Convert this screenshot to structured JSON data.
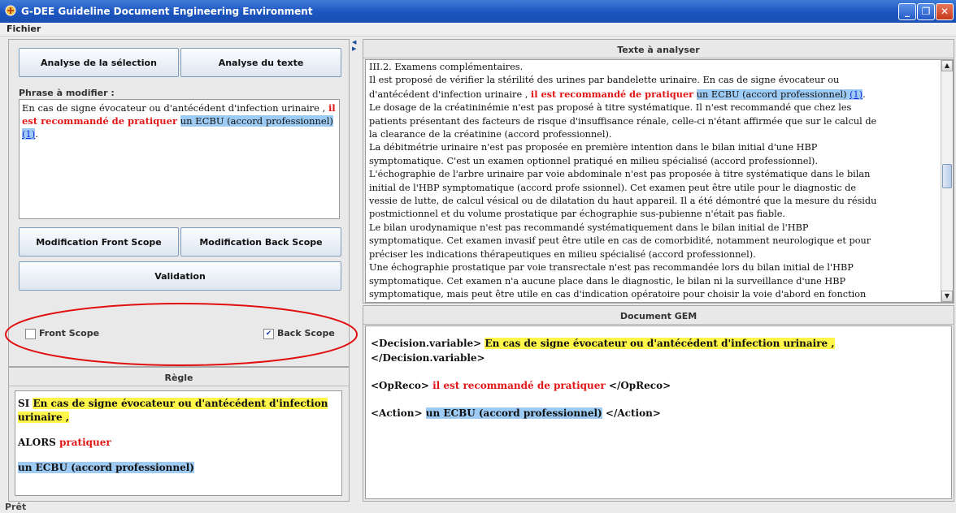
{
  "window": {
    "title": "G-DEE Guideline Document Engineering Environment",
    "minimize": "_",
    "maximize": "❐",
    "close": "✕"
  },
  "menu": {
    "fichier": "Fichier"
  },
  "left": {
    "btn_analyse_selection": "Analyse de la sélection",
    "btn_analyse_texte": "Analyse du texte",
    "phrase_label": "Phrase à modifier :",
    "phrase": {
      "part1": "En cas de signe évocateur ou d'antécédent d'infection urinaire , ",
      "part2": "il est recommandé de pratiquer",
      "part3": " ",
      "part4": "un ECBU (accord professionnel)",
      "part5": " ",
      "ref": "(1)",
      "end": "."
    },
    "btn_front": "Modification Front Scope",
    "btn_back": "Modification Back Scope",
    "btn_validation": "Validation",
    "front_scope": {
      "label": "Front Scope",
      "checked": false
    },
    "back_scope": {
      "label": "Back Scope",
      "checked": true,
      "mark": "✔"
    }
  },
  "regle": {
    "header": "Règle",
    "si": "SI",
    "condition": "En cas de signe évocateur ou d'antécédent d'infection urinaire ,",
    "alors": "ALORS",
    "pratiquer": "pratiquer",
    "action": "un ECBU (accord professionnel)"
  },
  "texte": {
    "header": "Texte à analyser",
    "l1": "III.2. Examens complémentaires.",
    "l2": "Il est proposé de vérifier la stérilité des urines par bandelette urinaire. En cas de signe évocateur ou",
    "l3a": "d'antécédent d'infection urinaire , ",
    "l3b": "il est recommandé de pratiquer",
    "l3c": " ",
    "l3d": "un ECBU (accord professionnel)",
    "l3e": " ",
    "l3ref": "(1)",
    "l3f": ".",
    "l4": "Le dosage de la créatininémie n'est pas proposé à titre systématique. Il n'est recommandé que chez les",
    "l5": "patients présentant des facteurs de risque d'insuffisance rénale, celle-ci n'étant affirmée que sur le calcul de",
    "l6": "la clearance de la créatinine (accord professionnel).",
    "l7": "La débitmétrie urinaire n'est pas proposée en première intention dans le bilan initial d'une HBP",
    "l8": "symptomatique. C'est un examen optionnel pratiqué en milieu spécialisé (accord professionnel).",
    "l9": "L'échographie de l'arbre urinaire par voie abdominale n'est pas proposée à titre systématique dans le bilan",
    "l10": "initial de l'HBP symptomatique (accord profe ssionnel). Cet examen peut être utile pour le diagnostic de",
    "l11": "vessie de lutte, de calcul vésical ou de dilatation du haut appareil. Il a été démontré que la mesure du résidu",
    "l12": "postmictionnel et du volume prostatique par échographie sus-pubienne n'était pas fiable.",
    "l13": "Le bilan urodynamique n'est pas recommandé systématiquement dans le bilan initial de l'HBP",
    "l14": "symptomatique. Cet examen invasif peut être utile en cas de comorbidité, notamment neurologique et pour",
    "l15": "préciser les indications thérapeutiques en milieu spécialisé (accord professionnel).",
    "l16": "Une échographie prostatique par voie transrectale n'est pas recommandée lors du bilan initial de l'HBP",
    "l17": "symptomatique. Cet examen n'a aucune place dans le diagnostic, le bilan ni la surveillance d'une HBP",
    "l18": "symptomatique, mais peut être utile en cas d'indication opératoire pour choisir la voie d'abord en fonction"
  },
  "gem": {
    "header": "Document GEM",
    "dv_open": "<Decision.variable>",
    "dv_text": "En cas de signe évocateur ou d'antécédent d'infection urinaire ,",
    "dv_close": "</Decision.variable>",
    "op_open": "<OpReco>",
    "op_text": "il est recommandé de pratiquer",
    "op_close": "</OpReco>",
    "ac_open": "<Action>",
    "ac_text": "un ECBU (accord professionnel)",
    "ac_close": "</Action>"
  },
  "status": "Prêt",
  "colors": {
    "accent_red": "#e01515",
    "highlight_blue": "#9ecbf4",
    "highlight_yellow": "#fff64a",
    "title_blue": "#1c55bf",
    "annotation_ellipse": "#e01010"
  }
}
